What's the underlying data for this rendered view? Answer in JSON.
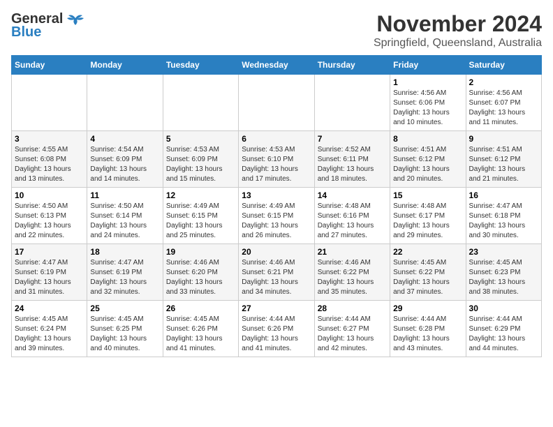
{
  "header": {
    "logo_line1": "General",
    "logo_line2": "Blue",
    "main_title": "November 2024",
    "subtitle": "Springfield, Queensland, Australia"
  },
  "calendar": {
    "days_of_week": [
      "Sunday",
      "Monday",
      "Tuesday",
      "Wednesday",
      "Thursday",
      "Friday",
      "Saturday"
    ],
    "weeks": [
      [
        {
          "day": "",
          "info": ""
        },
        {
          "day": "",
          "info": ""
        },
        {
          "day": "",
          "info": ""
        },
        {
          "day": "",
          "info": ""
        },
        {
          "day": "",
          "info": ""
        },
        {
          "day": "1",
          "info": "Sunrise: 4:56 AM\nSunset: 6:06 PM\nDaylight: 13 hours\nand 10 minutes."
        },
        {
          "day": "2",
          "info": "Sunrise: 4:56 AM\nSunset: 6:07 PM\nDaylight: 13 hours\nand 11 minutes."
        }
      ],
      [
        {
          "day": "3",
          "info": "Sunrise: 4:55 AM\nSunset: 6:08 PM\nDaylight: 13 hours\nand 13 minutes."
        },
        {
          "day": "4",
          "info": "Sunrise: 4:54 AM\nSunset: 6:09 PM\nDaylight: 13 hours\nand 14 minutes."
        },
        {
          "day": "5",
          "info": "Sunrise: 4:53 AM\nSunset: 6:09 PM\nDaylight: 13 hours\nand 15 minutes."
        },
        {
          "day": "6",
          "info": "Sunrise: 4:53 AM\nSunset: 6:10 PM\nDaylight: 13 hours\nand 17 minutes."
        },
        {
          "day": "7",
          "info": "Sunrise: 4:52 AM\nSunset: 6:11 PM\nDaylight: 13 hours\nand 18 minutes."
        },
        {
          "day": "8",
          "info": "Sunrise: 4:51 AM\nSunset: 6:12 PM\nDaylight: 13 hours\nand 20 minutes."
        },
        {
          "day": "9",
          "info": "Sunrise: 4:51 AM\nSunset: 6:12 PM\nDaylight: 13 hours\nand 21 minutes."
        }
      ],
      [
        {
          "day": "10",
          "info": "Sunrise: 4:50 AM\nSunset: 6:13 PM\nDaylight: 13 hours\nand 22 minutes."
        },
        {
          "day": "11",
          "info": "Sunrise: 4:50 AM\nSunset: 6:14 PM\nDaylight: 13 hours\nand 24 minutes."
        },
        {
          "day": "12",
          "info": "Sunrise: 4:49 AM\nSunset: 6:15 PM\nDaylight: 13 hours\nand 25 minutes."
        },
        {
          "day": "13",
          "info": "Sunrise: 4:49 AM\nSunset: 6:15 PM\nDaylight: 13 hours\nand 26 minutes."
        },
        {
          "day": "14",
          "info": "Sunrise: 4:48 AM\nSunset: 6:16 PM\nDaylight: 13 hours\nand 27 minutes."
        },
        {
          "day": "15",
          "info": "Sunrise: 4:48 AM\nSunset: 6:17 PM\nDaylight: 13 hours\nand 29 minutes."
        },
        {
          "day": "16",
          "info": "Sunrise: 4:47 AM\nSunset: 6:18 PM\nDaylight: 13 hours\nand 30 minutes."
        }
      ],
      [
        {
          "day": "17",
          "info": "Sunrise: 4:47 AM\nSunset: 6:19 PM\nDaylight: 13 hours\nand 31 minutes."
        },
        {
          "day": "18",
          "info": "Sunrise: 4:47 AM\nSunset: 6:19 PM\nDaylight: 13 hours\nand 32 minutes."
        },
        {
          "day": "19",
          "info": "Sunrise: 4:46 AM\nSunset: 6:20 PM\nDaylight: 13 hours\nand 33 minutes."
        },
        {
          "day": "20",
          "info": "Sunrise: 4:46 AM\nSunset: 6:21 PM\nDaylight: 13 hours\nand 34 minutes."
        },
        {
          "day": "21",
          "info": "Sunrise: 4:46 AM\nSunset: 6:22 PM\nDaylight: 13 hours\nand 35 minutes."
        },
        {
          "day": "22",
          "info": "Sunrise: 4:45 AM\nSunset: 6:22 PM\nDaylight: 13 hours\nand 37 minutes."
        },
        {
          "day": "23",
          "info": "Sunrise: 4:45 AM\nSunset: 6:23 PM\nDaylight: 13 hours\nand 38 minutes."
        }
      ],
      [
        {
          "day": "24",
          "info": "Sunrise: 4:45 AM\nSunset: 6:24 PM\nDaylight: 13 hours\nand 39 minutes."
        },
        {
          "day": "25",
          "info": "Sunrise: 4:45 AM\nSunset: 6:25 PM\nDaylight: 13 hours\nand 40 minutes."
        },
        {
          "day": "26",
          "info": "Sunrise: 4:45 AM\nSunset: 6:26 PM\nDaylight: 13 hours\nand 41 minutes."
        },
        {
          "day": "27",
          "info": "Sunrise: 4:44 AM\nSunset: 6:26 PM\nDaylight: 13 hours\nand 41 minutes."
        },
        {
          "day": "28",
          "info": "Sunrise: 4:44 AM\nSunset: 6:27 PM\nDaylight: 13 hours\nand 42 minutes."
        },
        {
          "day": "29",
          "info": "Sunrise: 4:44 AM\nSunset: 6:28 PM\nDaylight: 13 hours\nand 43 minutes."
        },
        {
          "day": "30",
          "info": "Sunrise: 4:44 AM\nSunset: 6:29 PM\nDaylight: 13 hours\nand 44 minutes."
        }
      ]
    ]
  }
}
